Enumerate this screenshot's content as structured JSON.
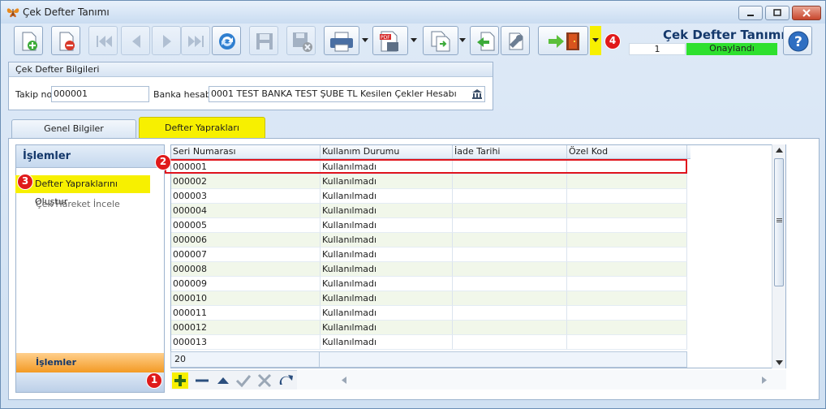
{
  "window": {
    "title": "Çek Defter Tanımı"
  },
  "header": {
    "form_title": "Çek Defter Tanımı",
    "status_number": "1",
    "status_label": "Onaylandı",
    "status_color": "#2ee02e"
  },
  "toolbar": {
    "buttons": [
      "new-document",
      "delete-document",
      "first-record",
      "previous-record",
      "next-record",
      "last-record",
      "refresh",
      "save",
      "save-and-close",
      "print",
      "export-pdf",
      "copy",
      "import",
      "tools",
      "transfer"
    ]
  },
  "annotations": [
    "1",
    "2",
    "3",
    "4"
  ],
  "group": {
    "title": "Çek Defter Bilgileri",
    "takip_label": "Takip no",
    "takip_value": "000001",
    "banka_label": "Banka hesabı",
    "banka_value": "0001 TEST BANKA TEST ŞUBE TL Kesilen Çekler Hesabı"
  },
  "tabs": [
    {
      "label": "Genel Bilgiler",
      "active": false
    },
    {
      "label": "Defter Yaprakları",
      "active": true
    }
  ],
  "sidebar": {
    "header": "İşlemler",
    "items": [
      {
        "label": "Defter Yapraklarını Oluştur"
      },
      {
        "label": "Çek Hareket İncele"
      }
    ],
    "footer": "İşlemler"
  },
  "grid": {
    "columns": [
      "Seri Numarası",
      "Kullanım Durumu",
      "İade Tarihi",
      "Özel Kod"
    ],
    "rows": [
      [
        "000001",
        "Kullanılmadı",
        "",
        ""
      ],
      [
        "000002",
        "Kullanılmadı",
        "",
        ""
      ],
      [
        "000003",
        "Kullanılmadı",
        "",
        ""
      ],
      [
        "000004",
        "Kullanılmadı",
        "",
        ""
      ],
      [
        "000005",
        "Kullanılmadı",
        "",
        ""
      ],
      [
        "000006",
        "Kullanılmadı",
        "",
        ""
      ],
      [
        "000007",
        "Kullanılmadı",
        "",
        ""
      ],
      [
        "000008",
        "Kullanılmadı",
        "",
        ""
      ],
      [
        "000009",
        "Kullanılmadı",
        "",
        ""
      ],
      [
        "000010",
        "Kullanılmadı",
        "",
        ""
      ],
      [
        "000011",
        "Kullanılmadı",
        "",
        ""
      ],
      [
        "000012",
        "Kullanılmadı",
        "",
        ""
      ],
      [
        "000013",
        "Kullanılmadı",
        "",
        ""
      ]
    ],
    "footer_count": "20"
  }
}
